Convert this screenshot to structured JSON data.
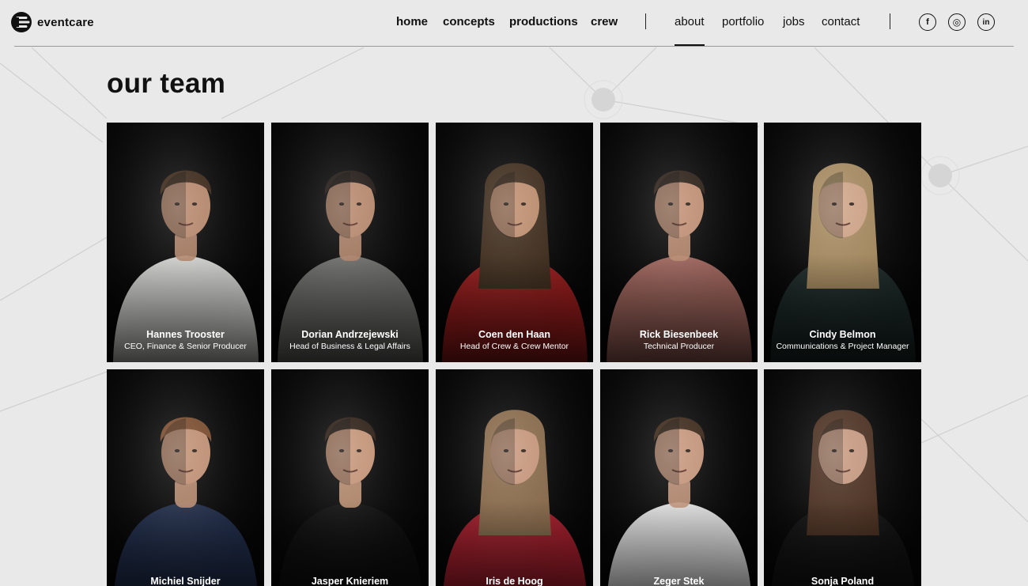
{
  "brand": {
    "name": "eventcare"
  },
  "nav": {
    "primary": [
      {
        "label": "home"
      },
      {
        "label": "concepts"
      },
      {
        "label": "productions"
      },
      {
        "label": "crew"
      }
    ],
    "secondary": [
      {
        "label": "about",
        "active": true
      },
      {
        "label": "portfolio"
      },
      {
        "label": "jobs"
      },
      {
        "label": "contact"
      }
    ],
    "social": [
      {
        "icon": "facebook-icon",
        "glyph": "f"
      },
      {
        "icon": "instagram-icon",
        "glyph": "◎"
      },
      {
        "icon": "linkedin-icon",
        "glyph": "in"
      }
    ]
  },
  "page": {
    "title": "our team"
  },
  "team": [
    {
      "name": "Hannes Trooster",
      "role": "CEO, Finance & Senior Producer",
      "shirt": "#d9d9d6",
      "skin": "#b8876a",
      "hair": "#3a2516"
    },
    {
      "name": "Dorian Andrzejewski",
      "role": "Head of Business & Legal Affairs",
      "shirt": "#6f6f6d",
      "skin": "#b8876a",
      "hair": "#1e1510"
    },
    {
      "name": "Coen den Haan",
      "role": "Head of Crew & Crew Mentor",
      "shirt": "#9c1c1c",
      "skin": "#c08d6c",
      "hair": "#3d2a1a"
    },
    {
      "name": "Rick Biesenbeek",
      "role": "Technical Producer",
      "shirt": "#a4675e",
      "skin": "#c39073",
      "hair": "#2b1e14"
    },
    {
      "name": "Cindy Belmon",
      "role": "Communications & Project Manager",
      "shirt": "#1c2a28",
      "skin": "#d1a486",
      "hair": "#a78a5e"
    },
    {
      "name": "Michiel Snijder",
      "role": "",
      "shirt": "#1f2c4a",
      "skin": "#c29072",
      "hair": "#7a4a2a"
    },
    {
      "name": "Jasper Knieriem",
      "role": "",
      "shirt": "#0d0d0d",
      "skin": "#c79576",
      "hair": "#2a1c12"
    },
    {
      "name": "Iris de Hoog",
      "role": "",
      "shirt": "#a81e2c",
      "skin": "#c9977a",
      "hair": "#8a6a4a"
    },
    {
      "name": "Zeger Stek",
      "role": "",
      "shirt": "#e8e8e8",
      "skin": "#c8967a",
      "hair": "#3a2616"
    },
    {
      "name": "Sonja Poland",
      "role": "",
      "shirt": "#111111",
      "skin": "#c99a80",
      "hair": "#4a2e1e"
    }
  ]
}
